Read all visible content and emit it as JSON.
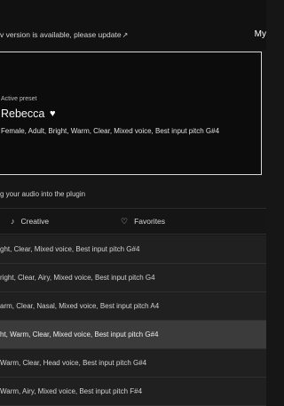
{
  "topbar": {
    "update_notice": "v version is available, please update",
    "update_arrow": "↗",
    "account_label": "My"
  },
  "preset": {
    "kicker": "Active preset",
    "name": "Rebecca",
    "heart": "♥",
    "tags": "Female, Adult, Bright, Warm, Clear, Mixed voice, Best input pitch  G#4"
  },
  "hint": "g your audio into the plugin",
  "tabs": [
    {
      "icon": "♪",
      "label": "Creative"
    },
    {
      "icon": "♡",
      "label": "Favorites"
    }
  ],
  "rows": [
    {
      "text": "ght, Clear, Mixed voice, Best input pitch G#4"
    },
    {
      "text": "right, Clear, Airy, Mixed voice, Best input pitch  G4"
    },
    {
      "text": "arm, Clear, Nasal, Mixed voice, Best input pitch  A4"
    },
    {
      "text": "ht, Warm, Clear, Mixed voice, Best input pitch  G#4"
    },
    {
      "text": "Warm, Clear, Head voice, Best input pitch G#4"
    },
    {
      "text": "Warm, Airy, Mixed voice, Best input pitch  F#4"
    }
  ]
}
